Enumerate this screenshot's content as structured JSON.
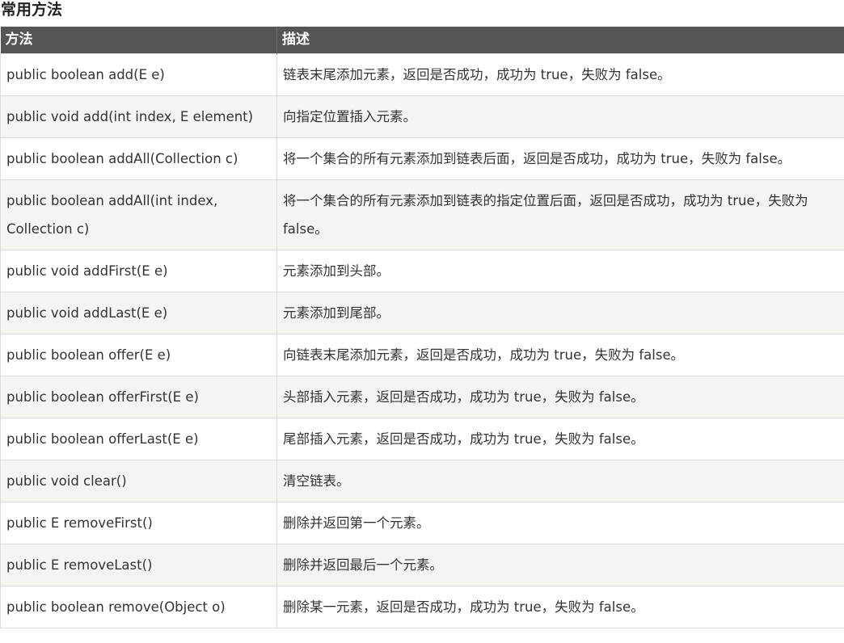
{
  "heading": "常用方法",
  "table": {
    "headers": [
      "方法",
      "描述"
    ],
    "rows": [
      {
        "method": "public boolean add(E e)",
        "description": "链表末尾添加元素，返回是否成功，成功为 true，失败为 false。"
      },
      {
        "method": "public void add(int index, E element)",
        "description": "向指定位置插入元素。"
      },
      {
        "method": "public boolean addAll(Collection c)",
        "description": "将一个集合的所有元素添加到链表后面，返回是否成功，成功为 true，失败为 false。"
      },
      {
        "method": "public boolean addAll(int index, Collection c)",
        "description": "将一个集合的所有元素添加到链表的指定位置后面，返回是否成功，成功为 true，失败为 false。"
      },
      {
        "method": "public void addFirst(E e)",
        "description": "元素添加到头部。"
      },
      {
        "method": "public void addLast(E e)",
        "description": "元素添加到尾部。"
      },
      {
        "method": "public boolean offer(E e)",
        "description": "向链表末尾添加元素，返回是否成功，成功为 true，失败为 false。"
      },
      {
        "method": "public boolean offerFirst(E e)",
        "description": "头部插入元素，返回是否成功，成功为 true，失败为 false。"
      },
      {
        "method": "public boolean offerLast(E e)",
        "description": "尾部插入元素，返回是否成功，成功为 true，失败为 false。"
      },
      {
        "method": "public void clear()",
        "description": "清空链表。"
      },
      {
        "method": "public E removeFirst()",
        "description": "删除并返回第一个元素。"
      },
      {
        "method": "public E removeLast()",
        "description": "删除并返回最后一个元素。"
      },
      {
        "method": "public boolean remove(Object o)",
        "description": "删除某一元素，返回是否成功，成功为 true，失败为 false。"
      }
    ]
  },
  "colors": {
    "header_bg": "#555555",
    "row_alt_bg": "#f5f4f0",
    "border": "#dddddd",
    "text": "#333333"
  }
}
